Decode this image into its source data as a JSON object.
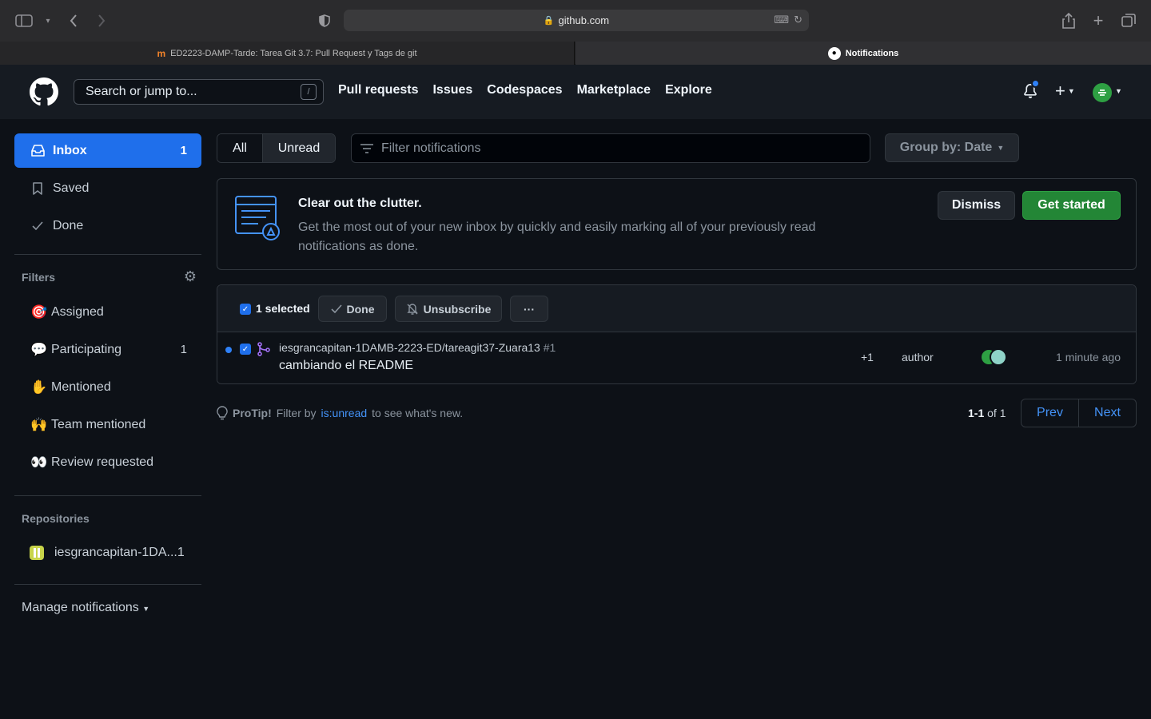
{
  "browser": {
    "url": "github.com",
    "tabs": [
      {
        "label": "ED2223-DAMP-Tarde: Tarea Git 3.7: Pull Request y Tags de git",
        "active": false
      },
      {
        "label": "Notifications",
        "active": true
      }
    ]
  },
  "header": {
    "search_placeholder": "Search or jump to...",
    "search_shortcut": "/",
    "nav": [
      "Pull requests",
      "Issues",
      "Codespaces",
      "Marketplace",
      "Explore"
    ],
    "plus": "+"
  },
  "sidebar": {
    "main_items": [
      {
        "label": "Inbox",
        "count": "1",
        "icon": "inbox-icon"
      },
      {
        "label": "Saved",
        "count": "",
        "icon": "bookmark-icon"
      },
      {
        "label": "Done",
        "count": "",
        "icon": "check-icon"
      }
    ],
    "filters_heading": "Filters",
    "filters": [
      {
        "emoji": "🎯",
        "label": "Assigned",
        "count": ""
      },
      {
        "emoji": "💬",
        "label": "Participating",
        "count": "1"
      },
      {
        "emoji": "✋",
        "label": "Mentioned",
        "count": ""
      },
      {
        "emoji": "🙌",
        "label": "Team mentioned",
        "count": ""
      },
      {
        "emoji": "👀",
        "label": "Review requested",
        "count": ""
      }
    ],
    "repos_heading": "Repositories",
    "repos": [
      {
        "label": "iesgrancapitan-1DA...",
        "count": "1"
      }
    ],
    "manage_label": "Manage notifications"
  },
  "toolbar": {
    "all_label": "All",
    "unread_label": "Unread",
    "filter_placeholder": "Filter notifications",
    "group_by_label": "Group by: Date"
  },
  "banner": {
    "title": "Clear out the clutter.",
    "text": "Get the most out of your new inbox by quickly and easily marking all of your previously read notifications as done.",
    "dismiss_label": "Dismiss",
    "get_started_label": "Get started"
  },
  "list": {
    "selected_label": "1 selected",
    "done_label": "Done",
    "unsubscribe_label": "Unsubscribe",
    "more_label": "···",
    "rows": [
      {
        "repo": "iesgrancapitan-1DAMB-2223-ED/tareagit37-Zuara13",
        "number": "#1",
        "title": "cambiando el README",
        "extra": "+1",
        "reason": "author",
        "time": "1 minute ago"
      }
    ]
  },
  "footer": {
    "protip_bold": "ProTip!",
    "protip_pre": "Filter by",
    "protip_link": "is:unread",
    "protip_post": "to see what's new.",
    "range_bold": "1-1",
    "range_rest": "of 1",
    "prev_label": "Prev",
    "next_label": "Next"
  },
  "colors": {
    "accent": "#1f6feb",
    "primary_button": "#238636",
    "background": "#0d1117",
    "header": "#161b22",
    "link": "#4493f8"
  }
}
